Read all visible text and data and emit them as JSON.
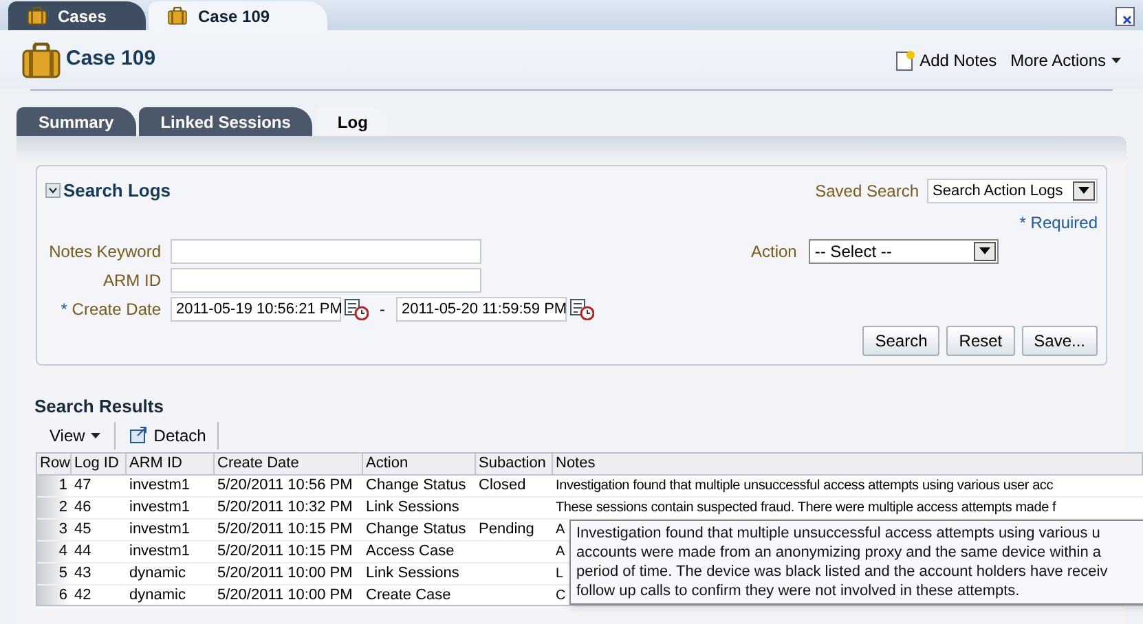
{
  "top_tabs": [
    {
      "label": "Cases",
      "selected": false
    },
    {
      "label": "Case 109",
      "selected": true
    }
  ],
  "header": {
    "title": "Case 109",
    "actions": [
      {
        "kind": "notes",
        "label": "Add Notes"
      },
      {
        "kind": "menu",
        "label": "More Actions"
      }
    ]
  },
  "sub_tabs": [
    {
      "label": "Summary",
      "selected": false
    },
    {
      "label": "Linked Sessions",
      "selected": false
    },
    {
      "label": "Log",
      "selected": true
    }
  ],
  "search_panel": {
    "title": "Search Logs",
    "expanded": true,
    "saved_search_label": "Saved Search",
    "saved_search_value": "Search Action Logs",
    "required_note": "* Required",
    "fields": [
      {
        "kind": "text",
        "label": "Notes Keyword"
      },
      {
        "kind": "text",
        "label": "ARM ID"
      },
      {
        "kind": "daterange",
        "label": "Create Date",
        "required_mark": "*",
        "from": "2011-05-19 10:56:21 PM",
        "separator": "-",
        "to": "2011-05-20 11:59:59 PM"
      }
    ],
    "action_field": {
      "label": "Action",
      "value": "-- Select --"
    },
    "buttons": [
      "Search",
      "Reset",
      "Save..."
    ]
  },
  "results": {
    "title": "Search Results",
    "toolbar": [
      {
        "kind": "menu",
        "label": "View"
      },
      {
        "kind": "detach",
        "label": "Detach"
      }
    ],
    "columns": [
      "Row",
      "Log ID",
      "ARM ID",
      "Create Date",
      "Action",
      "Subaction",
      "Notes"
    ],
    "rows": [
      [
        "1",
        "47",
        "investm1",
        "5/20/2011 10:56 PM",
        "Change Status",
        "Closed",
        "Investigation found that multiple unsuccessful access attempts using various user acc"
      ],
      [
        "2",
        "46",
        "investm1",
        "5/20/2011 10:32 PM",
        "Link Sessions",
        "",
        "These sessions contain suspected fraud. There were multiple access attempts made f"
      ],
      [
        "3",
        "45",
        "investm1",
        "5/20/2011 10:15 PM",
        "Change Status",
        "Pending",
        "A"
      ],
      [
        "4",
        "44",
        "investm1",
        "5/20/2011 10:15 PM",
        "Access Case",
        "",
        "A"
      ],
      [
        "5",
        "43",
        "dynamic",
        "5/20/2011 10:00 PM",
        "Link Sessions",
        "",
        "L"
      ],
      [
        "6",
        "42",
        "dynamic",
        "5/20/2011 10:00 PM",
        "Create Case",
        "",
        "C"
      ]
    ],
    "tooltip": [
      "Investigation found that multiple unsuccessful access attempts using various u",
      "accounts were made from an anonymizing proxy and the same device within a",
      "period of time. The device was black listed and the account holders have receiv",
      "follow up calls to confirm they were not involved in these attempts."
    ]
  }
}
